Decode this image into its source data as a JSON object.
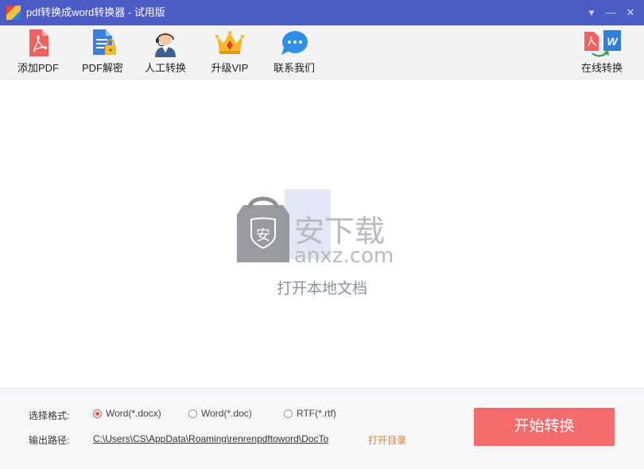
{
  "window": {
    "title": "pdf转换成word转换器 - 试用版"
  },
  "toolbar": {
    "add_pdf": "添加PDF",
    "pdf_decrypt": "PDF解密",
    "manual_convert": "人工转换",
    "upgrade_vip": "升级VIP",
    "contact_us": "联系我们",
    "online_convert": "在线转换"
  },
  "dropzone": {
    "watermark_char": "安",
    "watermark_brand": "安下载",
    "watermark_domain": "anxz.com",
    "open_label": "打开本地文档"
  },
  "options": {
    "format_label": "选择格式:",
    "formats": [
      {
        "label": "Word(*.docx)",
        "selected": true
      },
      {
        "label": "Word(*.doc)",
        "selected": false
      },
      {
        "label": "RTF(*.rtf)",
        "selected": false
      }
    ],
    "output_label": "输出路径:",
    "output_path": "C:\\Users\\CS\\AppData\\Roaming\\renrenpdftoword\\DocTo",
    "open_dir": "打开目录",
    "start_button": "开始转换"
  },
  "colors": {
    "titlebar": "#4c5cc7",
    "accent_red": "#f56b6b",
    "link_orange": "#e2793a"
  }
}
